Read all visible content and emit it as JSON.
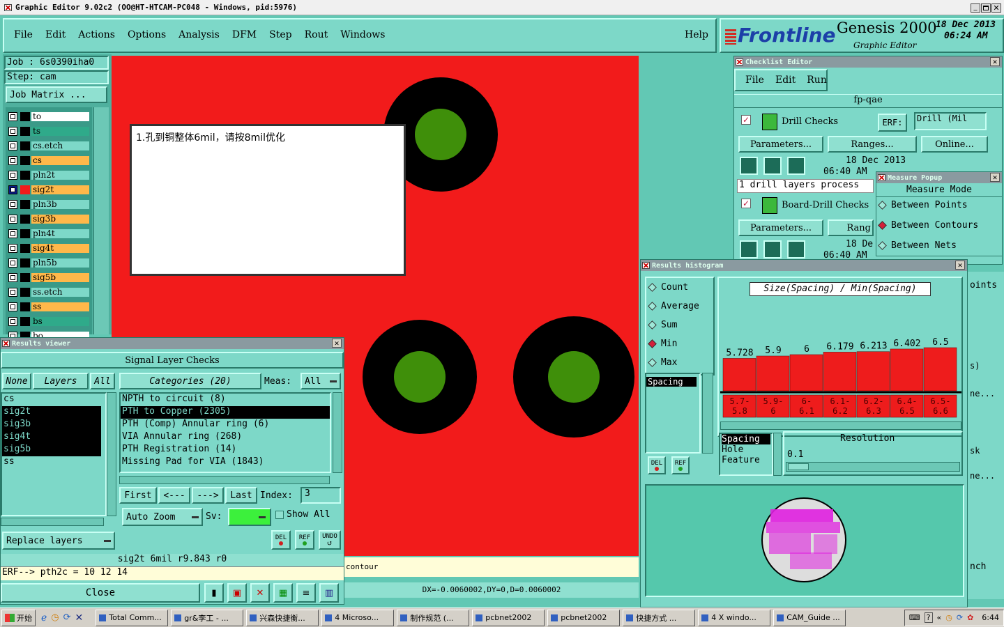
{
  "window": {
    "title": "Graphic Editor 9.02c2  (OO@HT-HTCAM-PC048 - Windows, pid:5976)"
  },
  "menu": {
    "items": [
      "File",
      "Edit",
      "Actions",
      "Options",
      "Analysis",
      "DFM",
      "Step",
      "Rout",
      "Windows"
    ],
    "help": "Help"
  },
  "brand": {
    "logo": "Frontline",
    "product": "Genesis 2000",
    "subtitle": "Graphic Editor",
    "date": "18 Dec 2013",
    "time": "06:24 AM"
  },
  "job": {
    "job_label": "Job  :  6s0390iha0",
    "step_label": "Step:  cam",
    "matrix_button": "Job Matrix ..."
  },
  "layers": [
    {
      "name": "to",
      "color": "#ffffff"
    },
    {
      "name": "ts",
      "color": "#2faa8a"
    },
    {
      "name": "cs.etch",
      "color": "#7dd8c8"
    },
    {
      "name": "cs",
      "color": "#ffb84a"
    },
    {
      "name": "pln2t",
      "color": "#7dd8c8"
    },
    {
      "name": "sig2t",
      "color": "#ffb84a"
    },
    {
      "name": "pln3b",
      "color": "#7dd8c8"
    },
    {
      "name": "sig3b",
      "color": "#ffb84a"
    },
    {
      "name": "pln4t",
      "color": "#7dd8c8"
    },
    {
      "name": "sig4t",
      "color": "#ffb84a"
    },
    {
      "name": "pln5b",
      "color": "#7dd8c8"
    },
    {
      "name": "sig5b",
      "color": "#ffb84a"
    },
    {
      "name": "ss.etch",
      "color": "#7dd8c8"
    },
    {
      "name": "ss",
      "color": "#ffb84a"
    },
    {
      "name": "bs",
      "color": "#2faa8a"
    },
    {
      "name": "bo",
      "color": "#ffffff"
    }
  ],
  "note": {
    "text": "1.孔到铜整体6mil，请按8mil优化"
  },
  "checklist": {
    "title": "Checklist Editor",
    "menu": [
      "File",
      "Edit",
      "Run"
    ],
    "name": "fp-qae",
    "check1": "Drill Checks",
    "erf_label": "ERF:",
    "erf_value": "Drill (Mil",
    "params": "Parameters...",
    "ranges": "Ranges...",
    "online": "Online...",
    "date1": "18 Dec 2013",
    "time1": "06:40 AM",
    "status": "1 drill layers process",
    "check2": "Board-Drill Checks",
    "params2": "Parameters...",
    "ranges2": "Rang",
    "date2": "18 De",
    "time2": "06:40 AM"
  },
  "measure": {
    "title": "Measure Popup",
    "mode": "Measure Mode",
    "options": [
      "Between Points",
      "Between Contours",
      "Between Nets"
    ],
    "selected": 1
  },
  "histogram": {
    "title": "Results histogram",
    "modes": [
      "Count",
      "Average",
      "Sum",
      "Min",
      "Max"
    ],
    "selected_mode": "Min",
    "list_item": "Spacing",
    "chart_title": "Size(Spacing) / Min(Spacing)",
    "resolution_label": "Resolution",
    "resolution_value": "0.1",
    "features": [
      "Spacing",
      "Hole",
      "Feature"
    ],
    "del": "DEL",
    "ref": "REF"
  },
  "chart_data": {
    "type": "bar",
    "title": "Size(Spacing) / Min(Spacing)",
    "categories": [
      "5.7-5.8",
      "5.9-6",
      "6-6.1",
      "6.1-6.2",
      "6.2-6.3",
      "6.4-6.5",
      "6.5-6.6"
    ],
    "values": [
      5.728,
      5.9,
      6,
      6.179,
      6.213,
      6.402,
      6.5
    ],
    "value_labels": [
      "5.728",
      "5.9",
      "6",
      "6.179",
      "6.213",
      "6.402",
      "6.5"
    ],
    "category_labels": [
      [
        "5.7-",
        "5.8"
      ],
      [
        "5.9-",
        "6"
      ],
      [
        "6-",
        "6.1"
      ],
      [
        "6.1-",
        "6.2"
      ],
      [
        "6.2-",
        "6.3"
      ],
      [
        "6.4-",
        "6.5"
      ],
      [
        "6.5-",
        "6.6"
      ]
    ]
  },
  "results": {
    "title": "Results viewer",
    "header": "Signal Layer Checks",
    "none": "None",
    "layers_btn": "Layers",
    "all": "All",
    "categories_btn": "Categories (20)",
    "meas_label": "Meas:",
    "meas_value": "All",
    "layer_list": [
      "cs",
      "sig2t",
      "sig3b",
      "sig4t",
      "sig5b",
      "ss"
    ],
    "layer_selected": [
      false,
      true,
      true,
      true,
      true,
      false
    ],
    "category_list": [
      "NPTH to circuit (8)",
      "PTH to Copper (2305)",
      "PTH (Comp) Annular ring (6)",
      "VIA Annular ring (268)",
      "PTH Registration (14)",
      "Missing Pad for VIA (1843)"
    ],
    "category_selected": 1,
    "first": "First",
    "prev": "<---",
    "next": "--->",
    "last": "Last",
    "index_label": "Index:",
    "index_value": "3",
    "auto_zoom": "Auto Zoom",
    "sv_label": "Sv:",
    "show_all": "Show All",
    "replace_layers": "Replace layers",
    "info": "sig2t  6mil   r9.843   r0",
    "erf": "ERF--> pth2c = 10 12 14",
    "close": "Close",
    "del": "DEL",
    "ref": "REF",
    "undo": "UNDO"
  },
  "status": {
    "contour": "contour",
    "delta": "DX=-0.0060002,DY=0,D=0.0060002"
  },
  "side": {
    "points": "oints",
    "sk": "sk",
    "ne1": "ne...",
    "ne2": "ne...",
    "nch": "nch",
    "s": "s)"
  },
  "taskbar": {
    "start": "开始",
    "items": [
      "Total Comm...",
      "gr&李工 - ...",
      "兴森快捷衡...",
      "4 Microso...",
      "制作规范 (...",
      "pcbnet2002",
      "pcbnet2002",
      "快捷方式 ...",
      "4 X windo...",
      "CAM_Guide ..."
    ],
    "clock": "6:44"
  }
}
